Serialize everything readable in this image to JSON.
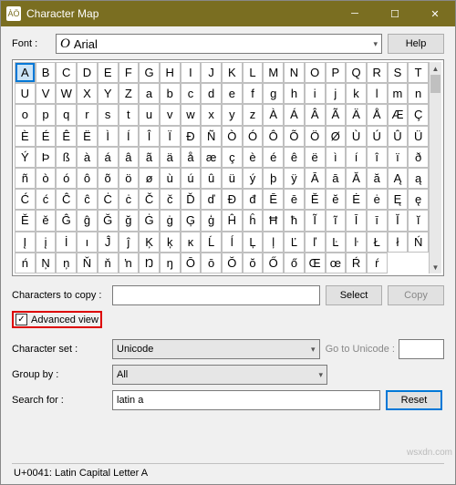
{
  "window": {
    "title": "Character Map",
    "icon_text": "ÀÖ"
  },
  "font_row": {
    "label": "Font :",
    "font_icon": "O",
    "font_name": "Arial",
    "help_btn": "Help"
  },
  "grid": {
    "selected_index": 0,
    "chars": [
      "A",
      "B",
      "C",
      "D",
      "E",
      "F",
      "G",
      "H",
      "I",
      "J",
      "K",
      "L",
      "M",
      "N",
      "O",
      "P",
      "Q",
      "R",
      "S",
      "T",
      "U",
      "V",
      "W",
      "X",
      "Y",
      "Z",
      "a",
      "b",
      "c",
      "d",
      "e",
      "f",
      "g",
      "h",
      "i",
      "j",
      "k",
      "l",
      "m",
      "n",
      "o",
      "p",
      "q",
      "r",
      "s",
      "t",
      "u",
      "v",
      "w",
      "x",
      "y",
      "z",
      "À",
      "Á",
      "Â",
      "Ã",
      "Ä",
      "Å",
      "Æ",
      "Ç",
      "È",
      "É",
      "Ê",
      "Ë",
      "Ì",
      "Í",
      "Î",
      "Ï",
      "Ð",
      "Ñ",
      "Ò",
      "Ó",
      "Ô",
      "Õ",
      "Ö",
      "Ø",
      "Ù",
      "Ú",
      "Û",
      "Ü",
      "Ý",
      "Þ",
      "ß",
      "à",
      "á",
      "â",
      "ã",
      "ä",
      "å",
      "æ",
      "ç",
      "è",
      "é",
      "ê",
      "ë",
      "ì",
      "í",
      "î",
      "ï",
      "ð",
      "ñ",
      "ò",
      "ó",
      "ô",
      "õ",
      "ö",
      "ø",
      "ù",
      "ú",
      "û",
      "ü",
      "ý",
      "þ",
      "ÿ",
      "Ā",
      "ā",
      "Ă",
      "ă",
      "Ą",
      "ą",
      "Ć",
      "ć",
      "Ĉ",
      "ĉ",
      "Ċ",
      "ċ",
      "Č",
      "č",
      "Ď",
      "ď",
      "Đ",
      "đ",
      "Ē",
      "ē",
      "Ĕ",
      "ĕ",
      "Ė",
      "ė",
      "Ę",
      "ę",
      "Ě",
      "ě",
      "Ĝ",
      "ĝ",
      "Ğ",
      "ğ",
      "Ġ",
      "ġ",
      "Ģ",
      "ģ",
      "Ĥ",
      "ĥ",
      "Ħ",
      "ħ",
      "Ĩ",
      "ĩ",
      "Ī",
      "ī",
      "Ĭ",
      "ĭ",
      "Į",
      "į",
      "İ",
      "ı",
      "Ĵ",
      "ĵ",
      "Ķ",
      "ķ",
      "ĸ",
      "Ĺ",
      "ĺ",
      "Ļ",
      "ļ",
      "Ľ",
      "ľ",
      "Ŀ",
      "ŀ",
      "Ł",
      "ł",
      "Ń",
      "ń",
      "Ņ",
      "ņ",
      "Ň",
      "ň",
      "ŉ",
      "Ŋ",
      "ŋ",
      "Ō",
      "ō",
      "Ŏ",
      "ŏ",
      "Ő",
      "ő",
      "Œ",
      "œ",
      "Ŕ",
      "ŕ"
    ]
  },
  "copy_row": {
    "label": "Characters to copy :",
    "value": "",
    "select_btn": "Select",
    "copy_btn": "Copy"
  },
  "advanced": {
    "checkbox_label": "Advanced view",
    "checked": true
  },
  "charset_row": {
    "label": "Character set :",
    "value": "Unicode",
    "goto_label": "Go to Unicode :",
    "goto_value": ""
  },
  "group_row": {
    "label": "Group by :",
    "value": "All"
  },
  "search_row": {
    "label": "Search for :",
    "value": "latin a",
    "reset_btn": "Reset"
  },
  "status": "U+0041: Latin Capital Letter A",
  "watermark": "wsxdn.com"
}
